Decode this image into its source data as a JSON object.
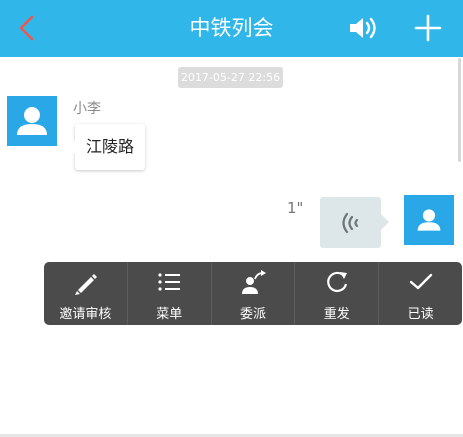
{
  "header": {
    "title": "中铁列会",
    "back_icon": "chevron-left-icon",
    "speaker_icon": "speaker-icon",
    "add_icon": "plus-icon"
  },
  "colors": {
    "header_bg": "#30b6e9",
    "back_arrow": "#e95a4c",
    "avatar": "#2aa7e6",
    "menu_bg": "#4b4b4b",
    "voice_bubble": "#dde6e8"
  },
  "chat": {
    "timestamp": "2017-05-27 22:56",
    "messages": [
      {
        "side": "left",
        "sender": "小李",
        "text": "江陵路"
      },
      {
        "side": "right",
        "type": "voice",
        "duration": "1\"",
        "icon": "voice-wave-icon"
      }
    ]
  },
  "context_menu": {
    "items": [
      {
        "label": "邀请审核",
        "icon": "pencil-icon"
      },
      {
        "label": "菜单",
        "icon": "list-icon"
      },
      {
        "label": "委派",
        "icon": "forward-user-icon"
      },
      {
        "label": "重发",
        "icon": "refresh-icon"
      },
      {
        "label": "已读",
        "icon": "check-icon"
      }
    ]
  }
}
